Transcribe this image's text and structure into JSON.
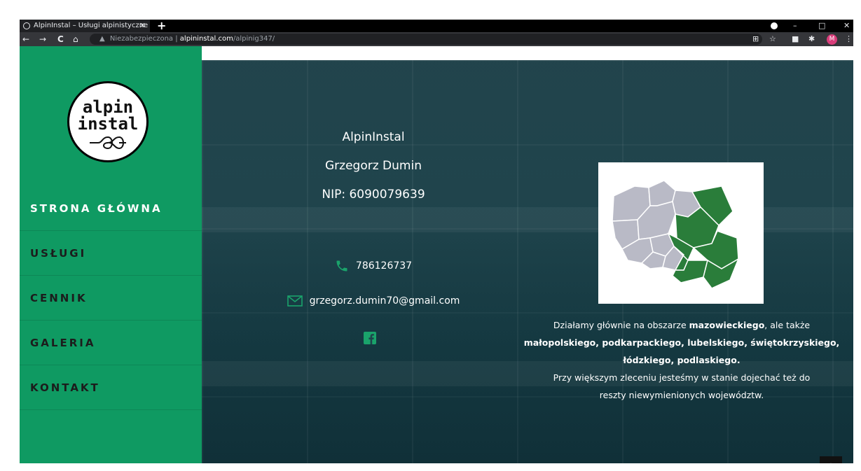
{
  "browser": {
    "tab_title": "AlpinInstal – Usługi alpinistyczne",
    "tab_close": "✕",
    "new_tab": "+",
    "window_minimize": "–",
    "window_maximize": "□",
    "window_close": "✕",
    "nav": {
      "back": "←",
      "forward": "→",
      "reload": "C",
      "home": "⌂"
    },
    "security_label": "Niezabezpieczona",
    "url_domain": "alpininstal.com",
    "url_path": "/alpinig347/",
    "profile_initial": "M",
    "profile_color": "#d93d7a"
  },
  "logo": {
    "line1": "alpin",
    "line2": "instal"
  },
  "sidebar": {
    "color": "#0f9a62",
    "items": [
      {
        "label": "STRONA GŁÓWNA",
        "active": true
      },
      {
        "label": "USŁUGI",
        "active": false
      },
      {
        "label": "CENNIK",
        "active": false
      },
      {
        "label": "GALERIA",
        "active": false
      },
      {
        "label": "KONTAKT",
        "active": false
      }
    ]
  },
  "company": {
    "name": "AlpinInstal",
    "owner": "Grzegorz Dumin",
    "nip": "NIP: 6090079639",
    "phone": "786126737",
    "email": "grzegorz.dumin70@gmail.com",
    "accent": "#1aa36b"
  },
  "info": {
    "line1_pre": "Działamy głównie na obszarze ",
    "line1_bold": "mazowieckiego",
    "line1_post": ", ale także",
    "line2_bold": "małopolskiego, podkarpackiego, lubelskiego, świętokrzyskiego,",
    "line3_bold": "łódzkiego, podlaskiego.",
    "line4": "Przy większym zleceniu jesteśmy w stanie dojechać też do",
    "line5": "reszty niewymienionych województw."
  },
  "map": {
    "highlight_color": "#2a7d3a",
    "base_color": "#b9bac6"
  },
  "scroll_top": "⌃"
}
